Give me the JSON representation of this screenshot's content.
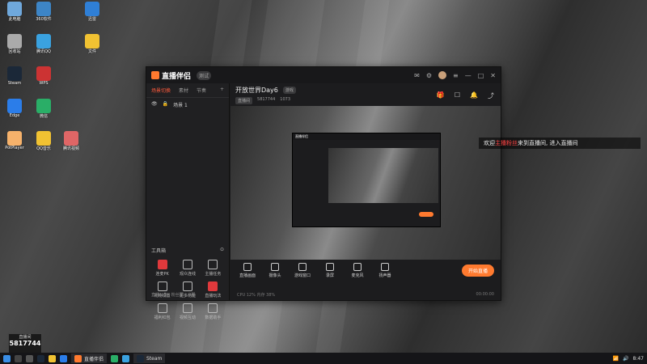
{
  "desktop": {
    "icons": [
      {
        "label": "此电脑",
        "color": "#6fa8dc"
      },
      {
        "label": "360软件",
        "color": "#3d85c6"
      },
      {
        "label": "迅雷",
        "color": "#2f7fd6"
      },
      {
        "label": "回收站",
        "color": "#aaaaaa"
      },
      {
        "label": "腾讯QQ",
        "color": "#3aa2e0"
      },
      {
        "label": "文件",
        "color": "#f1c232"
      },
      {
        "label": "Steam",
        "color": "#1b2838"
      },
      {
        "label": "WPS",
        "color": "#cc3333"
      },
      {
        "label": "Edge",
        "color": "#2b7de9"
      },
      {
        "label": "微信",
        "color": "#2aae67"
      },
      {
        "label": "PotPlayer",
        "color": "#f6b26b"
      },
      {
        "label": "QQ音乐",
        "color": "#f1c232"
      },
      {
        "label": "腾讯视频",
        "color": "#e06666"
      }
    ]
  },
  "app": {
    "name": "直播伴侣",
    "badge": "测试",
    "left_tabs": [
      "场景切换",
      "素材",
      "节奏"
    ],
    "scene": "场景 1",
    "tools_title": "工具箱",
    "tools": [
      {
        "label": "连麦PK"
      },
      {
        "label": "观众连线"
      },
      {
        "label": "主播任务"
      },
      {
        "label": "礼物设置"
      },
      {
        "label": "更多功能"
      },
      {
        "label": "直播玩法"
      },
      {
        "label": "福利红包"
      },
      {
        "label": "视频互动"
      },
      {
        "label": "数据助手"
      }
    ],
    "left_footer": "直播公告 · 粉丝团 · 点赞",
    "stream_title": "开放世界Day6",
    "title_tag": "游戏",
    "meta_tag": "直播间",
    "room_id": "5817744",
    "viewers": "1073",
    "controls": [
      "直播画面",
      "摄像头",
      "游戏窗口",
      "录屏",
      "麦克风",
      "扬声器"
    ],
    "go_live": "开始直播",
    "status_left": "CPU 12%  内存 38%",
    "status_right": "00:00:00"
  },
  "welcome": {
    "prefix": "欢迎",
    "name": "主播粉丝",
    "suffix": "来到直播间, 进入直播间"
  },
  "stream_card": {
    "title": "直播间",
    "id": "5817744"
  },
  "taskbar": {
    "app_task": "直播伴侣",
    "steam_task": "Steam",
    "clock": "8:47"
  }
}
